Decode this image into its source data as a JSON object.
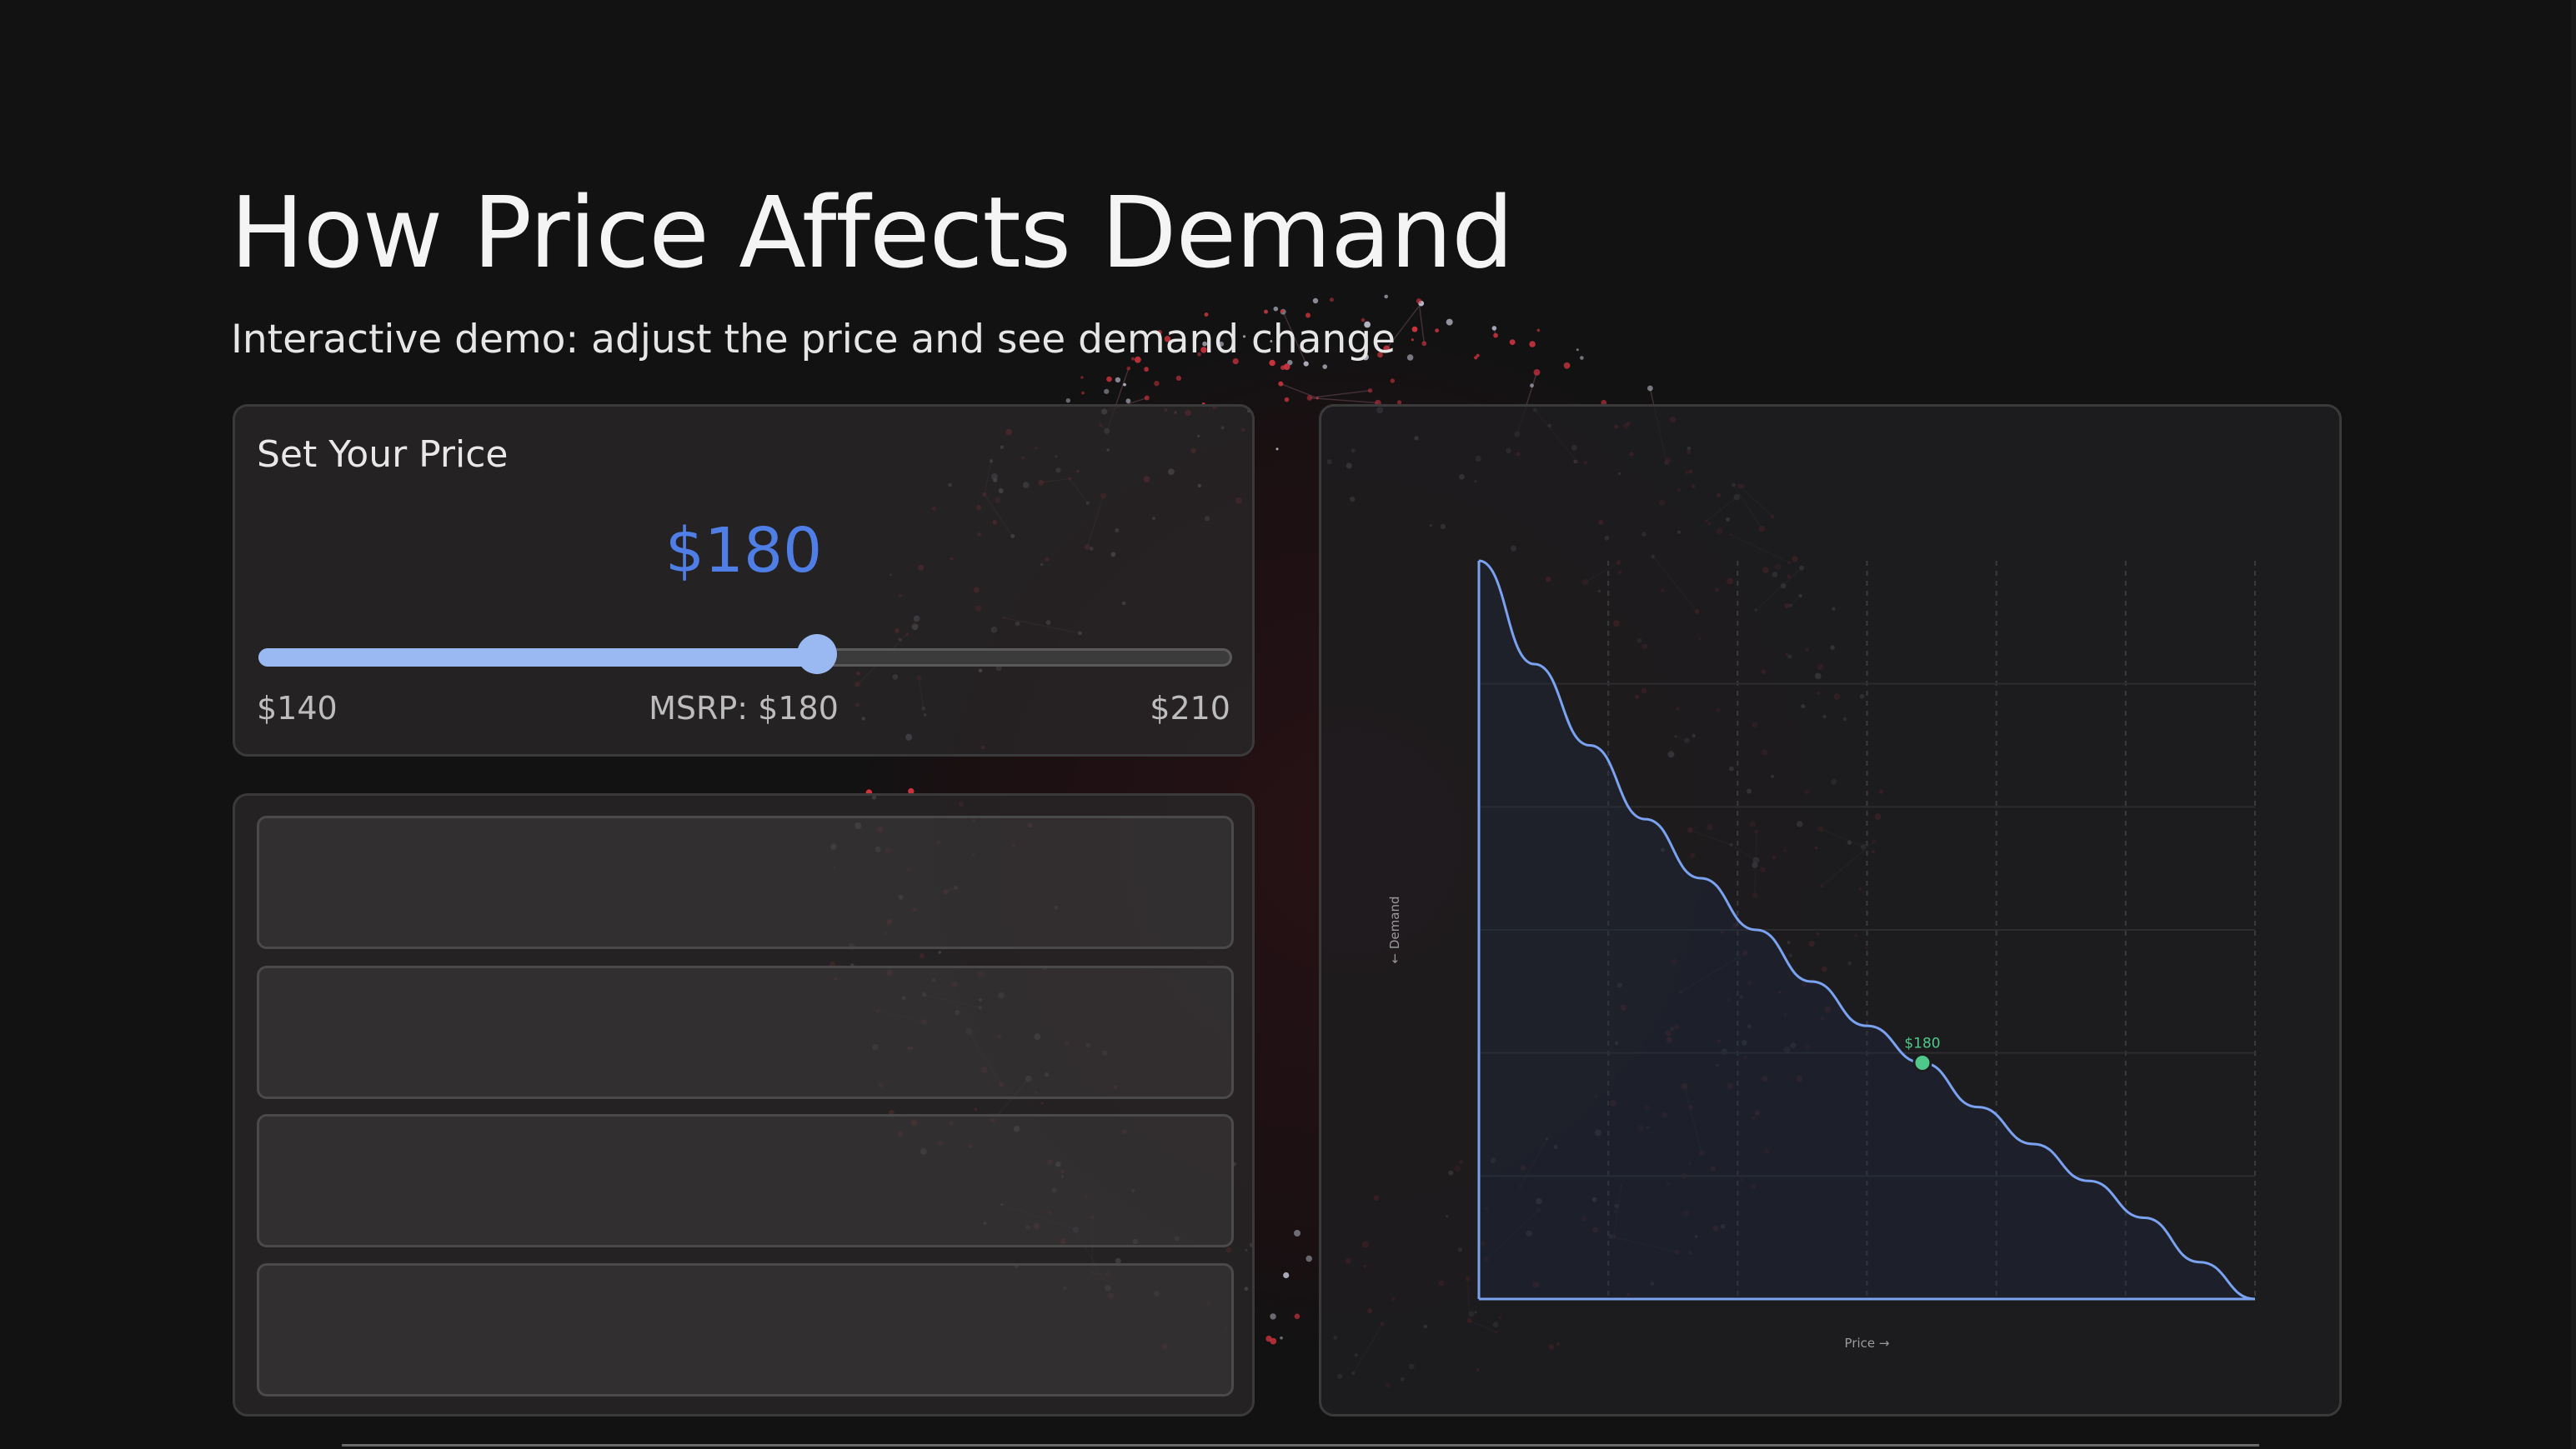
{
  "header": {
    "title": "How Price Affects Demand",
    "subtitle": "Interactive demo: adjust the price and see demand change"
  },
  "price_control": {
    "heading": "Set Your Price",
    "price_display": "$180",
    "min_label": "$140",
    "mid_label": "MSRP: $180",
    "max_label": "$210",
    "min": 140,
    "max": 210,
    "value": 180
  },
  "metrics": {
    "slots": [
      {},
      {},
      {},
      {}
    ]
  },
  "chart_data": {
    "type": "line",
    "title": "",
    "xlabel": "Price →",
    "ylabel": "← Demand",
    "xlim": [
      140,
      210
    ],
    "ylim": [
      0,
      1
    ],
    "grid": true,
    "x": [
      140,
      145,
      150,
      155,
      160,
      165,
      170,
      175,
      180,
      185,
      190,
      195,
      200,
      205,
      210
    ],
    "y": [
      1.0,
      0.86,
      0.75,
      0.65,
      0.57,
      0.5,
      0.43,
      0.37,
      0.32,
      0.26,
      0.21,
      0.16,
      0.11,
      0.05,
      0.0
    ],
    "marker": {
      "x": 180,
      "y": 0.32,
      "label": "$180"
    }
  },
  "colors": {
    "accent": "#4f7fe6",
    "slider": "#9ab8f1",
    "curve": "#7aa2f0",
    "marker": "#4fc98a",
    "background": "#121212"
  }
}
